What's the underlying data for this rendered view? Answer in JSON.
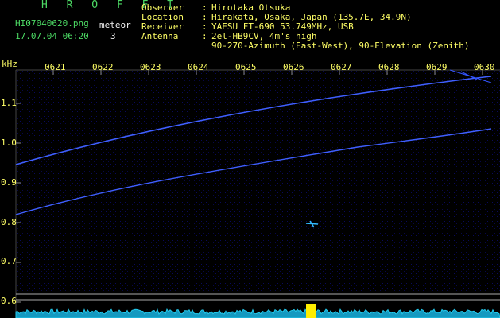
{
  "header": {
    "title": "H R O F F T",
    "filename": "HI07040620.png",
    "datetime": "17.07.04 06:20",
    "meteor_label": "meteor",
    "meteor_count": "3"
  },
  "info": [
    {
      "key": "Observer",
      "value": "Hirotaka Otsuka"
    },
    {
      "key": "Location",
      "value": "Hirakata, Osaka, Japan (135.7E, 34.9N)"
    },
    {
      "key": "Receiver",
      "value": "YAESU FT-690 53.749MHz, USB"
    },
    {
      "key": "Antenna",
      "value": "2el-HB9CV, 4m's high"
    },
    {
      "key": "",
      "value": "90-270-Azimuth (East-West), 90-Elevation (Zenith)"
    }
  ],
  "axis": {
    "y_unit": "kHz",
    "y_ticks": [
      "1.1",
      "1.0",
      "0.9",
      "0.8",
      "0.7",
      "0.6"
    ],
    "x_ticks": [
      "0621",
      "0622",
      "0623",
      "0624",
      "0625",
      "0626",
      "0627",
      "0628",
      "0629",
      "0630"
    ]
  },
  "colors": {
    "header_title": "#4cd964",
    "label_yellow": "#ffff66",
    "trace_blue": "#3355ff",
    "baseline_cyan": "#22ccee"
  }
}
